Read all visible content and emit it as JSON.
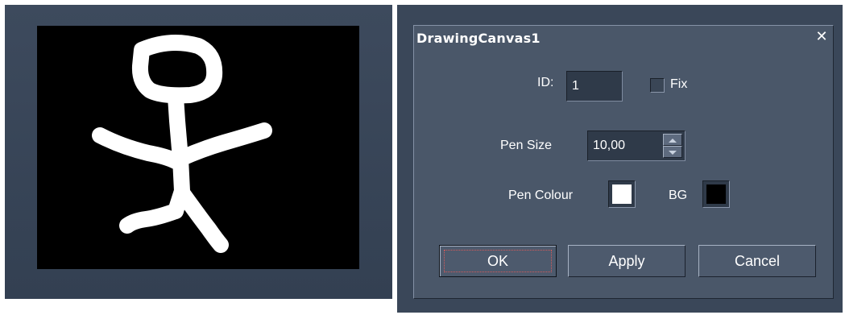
{
  "canvas": {
    "background_color": "#000000",
    "stroke_color": "#ffffff"
  },
  "dialog": {
    "title": "DrawingCanvas1",
    "close_icon": "close-icon",
    "id_label": "ID:",
    "id_value": "1",
    "fix_label": "Fix",
    "fix_checked": false,
    "pen_size_label": "Pen Size",
    "pen_size_value": "10,00",
    "pen_colour_label": "Pen Colour",
    "pen_colour": "#ffffff",
    "bg_label": "BG",
    "bg_colour": "#000000",
    "buttons": {
      "ok": "OK",
      "apply": "Apply",
      "cancel": "Cancel"
    }
  }
}
